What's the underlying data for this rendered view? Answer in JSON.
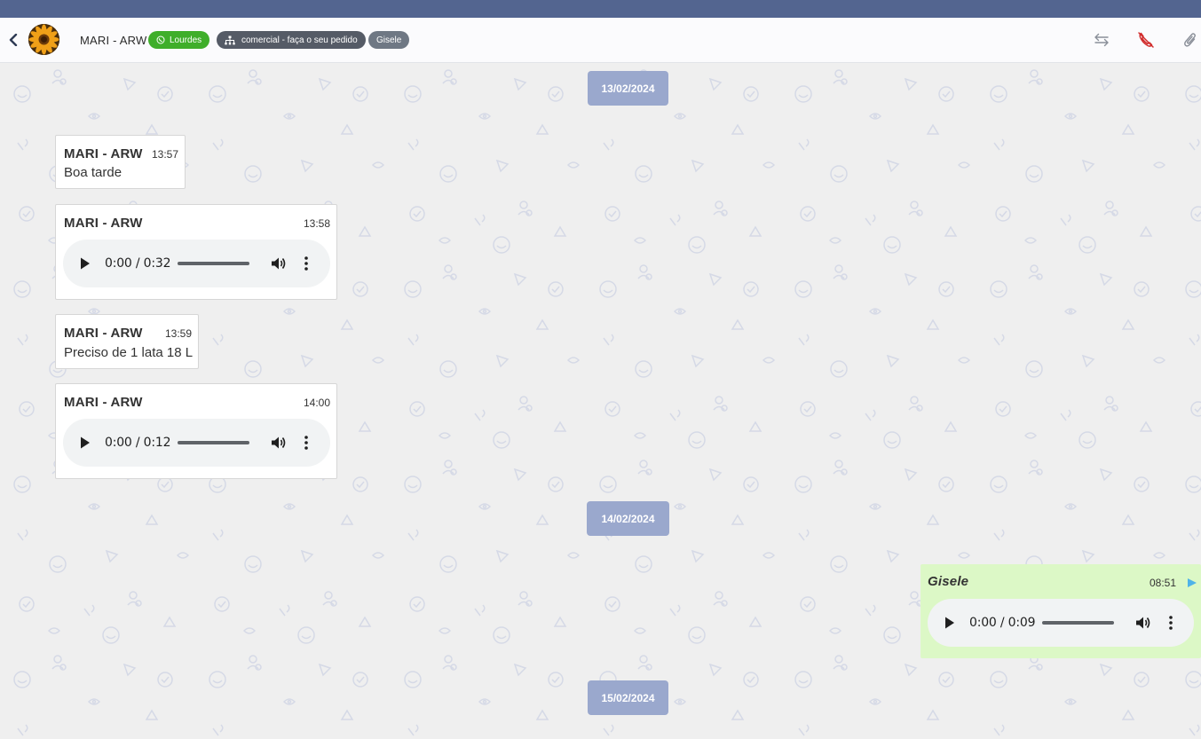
{
  "header": {
    "contact_name": "MARI - ARW",
    "connection_badge": "Lourdes",
    "queue_badge": "comercial - faça o seu pedido",
    "user_badge": "Gisele",
    "icons": [
      "chevron-left-icon",
      "transfer-icon",
      "hangup-icon",
      "attach-icon"
    ]
  },
  "chat": {
    "dates": [
      "13/02/2024",
      "14/02/2024",
      "15/02/2024"
    ],
    "messages": [
      {
        "sender": "MARI - ARW",
        "time": "13:57",
        "text": "Boa tarde"
      },
      {
        "sender": "MARI - ARW",
        "time": "13:58",
        "audio": {
          "current": "0:00",
          "duration": "0:32",
          "display": "0:00 / 0:32"
        }
      },
      {
        "sender": "MARI - ARW",
        "time": "13:59",
        "text": "Preciso de 1 lata 18 L"
      },
      {
        "sender": "MARI - ARW",
        "time": "14:00",
        "audio": {
          "current": "0:00",
          "duration": "0:12",
          "display": "0:00 / 0:12"
        }
      },
      {
        "sender": "Gisele",
        "time": "08:51",
        "outgoing": true,
        "audio": {
          "current": "0:00",
          "duration": "0:09",
          "display": "0:00 / 0:09"
        }
      }
    ]
  },
  "colors": {
    "topbar": "#536590",
    "date_pill": "#9aa8cd",
    "outgoing_bubble": "#dcf8c6",
    "connection_badge": "#3fae2a",
    "queue_badge": "#555b66",
    "user_badge": "#6f7884",
    "hangup_icon": "#d12b2b",
    "sent_icon": "#4fb3e8"
  }
}
